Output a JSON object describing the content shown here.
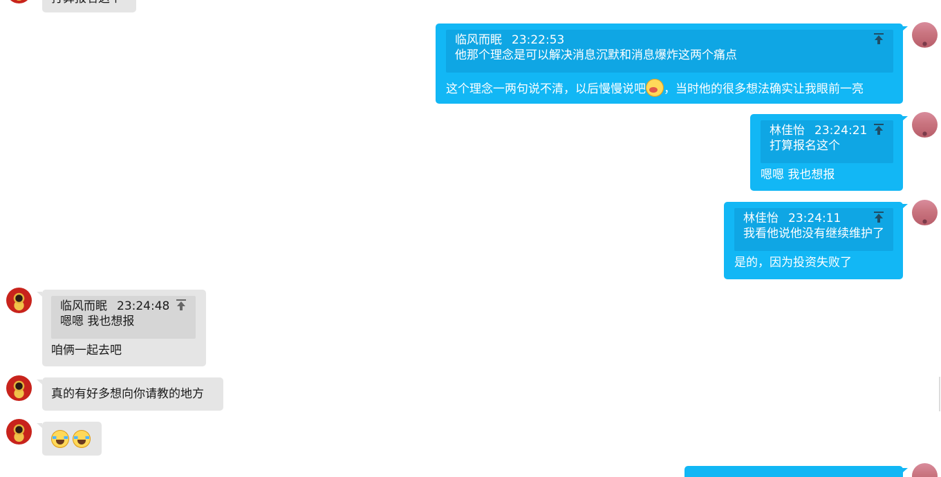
{
  "messages": {
    "m0": {
      "reply": "打算报名这个"
    },
    "m1": {
      "quote_sender": "临风而眠",
      "quote_time": "23:22:53",
      "quote_text": "他那个理念是可以解决消息沉默和消息爆炸这两个痛点",
      "reply_before": "这个理念一两句说不清，以后慢慢说吧",
      "emoji": "yawn-emoji",
      "reply_after": "，当时他的很多想法确实让我眼前一亮"
    },
    "m2": {
      "quote_sender": "林佳怡",
      "quote_time": "23:24:21",
      "quote_text": "打算报名这个",
      "reply": "嗯嗯 我也想报"
    },
    "m3": {
      "quote_sender": "林佳怡",
      "quote_time": "23:24:11",
      "quote_text": "我看他说他没有继续维护了",
      "reply": "是的，因为投资失败了"
    },
    "m4": {
      "quote_sender": "临风而眠",
      "quote_time": "23:24:48",
      "quote_text": "嗯嗯 我也想报",
      "reply": "咱俩一起去吧"
    },
    "m5": {
      "reply": "真的有好多想向你请教的地方"
    },
    "m6": {
      "emojis": [
        "cry-laugh-emoji",
        "cry-laugh-emoji"
      ]
    }
  },
  "colors": {
    "self_bubble": "#12b7f5",
    "self_quote": "#0fa6e4",
    "other_bubble": "#e5e5e5",
    "other_quote": "#d6d6d6"
  }
}
